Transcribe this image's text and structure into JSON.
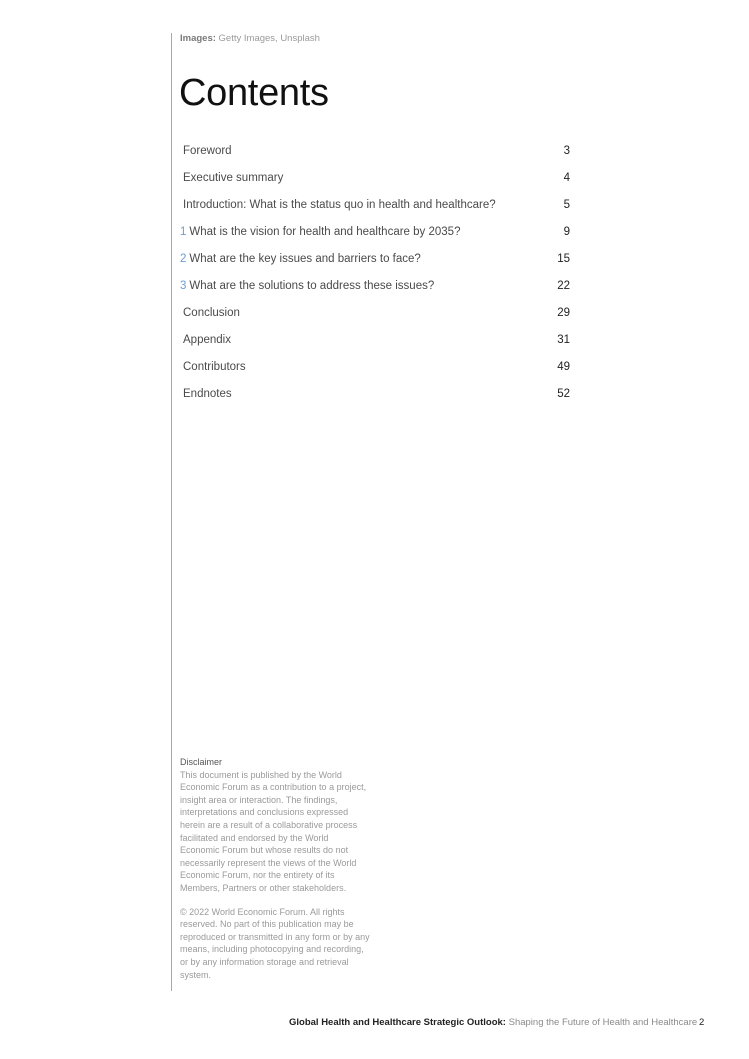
{
  "credits": {
    "label": "Images:",
    "value": "Getty Images, Unsplash"
  },
  "title": "Contents",
  "toc": [
    {
      "num": "",
      "label": "Foreword",
      "page": "3"
    },
    {
      "num": "",
      "label": "Executive summary",
      "page": "4"
    },
    {
      "num": "",
      "label": "Introduction: What is the status quo in health and healthcare?",
      "page": "5"
    },
    {
      "num": "1",
      "label": "What is the vision for health and healthcare by 2035?",
      "page": "9"
    },
    {
      "num": "2",
      "label": "What are the key issues and barriers to face?",
      "page": "15"
    },
    {
      "num": "3",
      "label": "What are the solutions to address these issues?",
      "page": "22"
    },
    {
      "num": "",
      "label": "Conclusion",
      "page": "29"
    },
    {
      "num": "",
      "label": "Appendix",
      "page": "31"
    },
    {
      "num": "",
      "label": "Contributors",
      "page": "49"
    },
    {
      "num": "",
      "label": "Endnotes",
      "page": "52"
    }
  ],
  "disclaimer": {
    "heading": "Disclaimer",
    "body": "This document is published by the World Economic Forum as a contribution to a project, insight area or interaction. The findings, interpretations and conclusions expressed herein are a result of a collaborative process facilitated and endorsed by the World Economic Forum but whose results do not necessarily represent the views of the World Economic Forum, nor the entirety of its Members, Partners or other stakeholders.",
    "copyright": "© 2022 World Economic Forum. All rights reserved. No part of this publication may be reproduced or transmitted in any form or by any means, including photocopying and recording, or by any information storage and retrieval system."
  },
  "footer": {
    "title_bold": "Global Health and Healthcare Strategic Outlook:",
    "subtitle": "Shaping the Future of Health and Healthcare",
    "page_number": "2"
  },
  "colors": {
    "accent_number": "#6d9bd6",
    "rule": "#a8a8a8"
  }
}
